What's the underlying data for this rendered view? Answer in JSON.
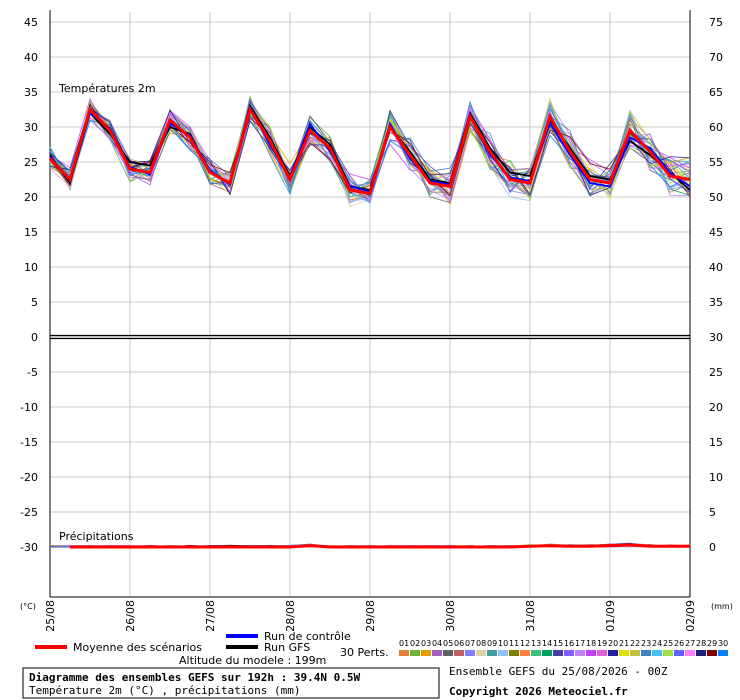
{
  "chart_data": {
    "type": "line",
    "title": "Diagramme des ensembles GEFS sur 192h : 39.4N 0.5W",
    "subtitle": "Température 2m (°C) , précipitations (mm)",
    "temp_label": "Températures 2m",
    "precip_label": "Précipitations",
    "left_unit": "(°C)",
    "right_unit": "(mm)",
    "altitude_text": "Altitude du modele : 199m",
    "run_text": "Ensemble GEFS du 25/08/2026 - 00Z",
    "copyright": "Copyright 2026 Meteociel.fr",
    "left_ticks": [
      "45",
      "40",
      "35",
      "30",
      "25",
      "20",
      "15",
      "10",
      "5",
      "0",
      "-5",
      "-10",
      "-15",
      "-20",
      "-25",
      "-30"
    ],
    "right_ticks": [
      "75",
      "70",
      "65",
      "60",
      "55",
      "50",
      "45",
      "40",
      "35",
      "30",
      "25",
      "20",
      "15",
      "10",
      "5",
      "0"
    ],
    "x_ticks": [
      "25/08",
      "26/08",
      "27/08",
      "28/08",
      "29/08",
      "30/08",
      "31/08",
      "01/09",
      "02/09"
    ],
    "ylim_left": [
      -30,
      45
    ],
    "x_hours": [
      0,
      6,
      12,
      18,
      24,
      30,
      36,
      42,
      48,
      54,
      60,
      66,
      72,
      78,
      84,
      90,
      96,
      102,
      108,
      114,
      120,
      126,
      132,
      138,
      144,
      150,
      156,
      162,
      168,
      174,
      180,
      186,
      192
    ],
    "series": [
      {
        "name": "Moyenne des scénarios",
        "color": "#ff0000",
        "values": [
          25.5,
          22.5,
          32.5,
          29.5,
          24,
          23.5,
          31,
          28.5,
          23.5,
          22,
          32.5,
          28,
          22.5,
          29.5,
          27,
          21,
          20.5,
          30,
          26,
          22,
          21.5,
          31.5,
          26.5,
          22.5,
          22,
          31.5,
          26.5,
          22.5,
          22,
          29.5,
          26.5,
          23,
          22.5
        ]
      },
      {
        "name": "Run de contrôle",
        "color": "#0000ff",
        "values": [
          25.8,
          22.3,
          32.0,
          29.8,
          24.3,
          23.2,
          30.5,
          28.8,
          23.8,
          21.8,
          32.8,
          27.5,
          22.8,
          30.5,
          26.5,
          21.5,
          20.8,
          30.5,
          25.5,
          22.3,
          21.8,
          31.8,
          26.0,
          22.8,
          22.3,
          30.5,
          26.0,
          22.0,
          21.5,
          28.5,
          27.0,
          23.5,
          21.5
        ]
      },
      {
        "name": "Run GFS",
        "color": "#000000",
        "values": [
          26.0,
          22.0,
          32.0,
          29.0,
          25.0,
          24.5,
          30.0,
          29.0,
          23.5,
          22.0,
          33.0,
          28.5,
          23.0,
          30.0,
          27.5,
          21.5,
          21.0,
          30.0,
          26.5,
          22.5,
          22.0,
          32.0,
          27.0,
          23.5,
          23.0,
          31.0,
          27.0,
          23.0,
          22.5,
          28.0,
          26.0,
          23.5,
          21.0
        ]
      }
    ],
    "precip_mean": [
      0,
      0,
      0,
      0,
      0,
      0,
      0,
      0,
      0,
      0,
      0,
      0,
      0,
      0.2,
      0,
      0,
      0,
      0,
      0,
      0,
      0,
      0,
      0,
      0,
      0.1,
      0.2,
      0.1,
      0.1,
      0.2,
      0.3,
      0.1,
      0.1,
      0.1
    ],
    "perturbation_count": 30,
    "perturbation_label": "30 Perts.",
    "perturbation_ids": [
      "01",
      "02",
      "03",
      "04",
      "05",
      "06",
      "07",
      "08",
      "09",
      "10",
      "11",
      "12",
      "13",
      "14",
      "15",
      "16",
      "17",
      "18",
      "19",
      "20",
      "21",
      "22",
      "23",
      "24",
      "25",
      "26",
      "27",
      "28",
      "29",
      "30"
    ],
    "perturbation_colors": [
      "#e08030",
      "#70b030",
      "#e0a000",
      "#a060c0",
      "#606060",
      "#c06060",
      "#8080ff",
      "#e0d0a0",
      "#40a0a0",
      "#90c0ff",
      "#808000",
      "#ff8040",
      "#40c080",
      "#00a060",
      "#4040a0",
      "#8060ff",
      "#c080ff",
      "#c040ff",
      "#e060e0",
      "#2020a0",
      "#e0e000",
      "#c0c040",
      "#4080c0",
      "#40c0ff",
      "#a0e040",
      "#6060ff",
      "#ff80ff",
      "#202080",
      "#800000",
      "#0080ff"
    ]
  },
  "legend": {
    "mean_label": "Moyenne des scénarios",
    "control_label": "Run de contrôle",
    "gfs_label": "Run GFS"
  }
}
